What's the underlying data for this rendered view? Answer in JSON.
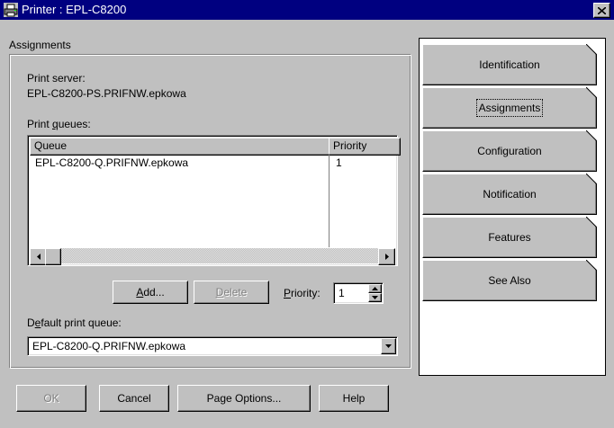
{
  "window": {
    "title": "Printer : EPL-C8200"
  },
  "page": {
    "heading": "Assignments",
    "print_server_label": "Print server:",
    "print_server_value": "EPL-C8200-PS.PRIFNW.epkowa",
    "print_queues_label": "Print queues:",
    "queues_table": {
      "columns": [
        "Queue",
        "Priority"
      ],
      "rows": [
        {
          "queue": "EPL-C8200-Q.PRIFNW.epkowa",
          "priority": "1"
        }
      ]
    },
    "add_label": "Add...",
    "delete_label": "Delete",
    "priority_label": "Priority:",
    "priority_value": "1",
    "default_queue_label": "Default print queue:",
    "default_queue_value": "EPL-C8200-Q.PRIFNW.epkowa"
  },
  "tabs": [
    {
      "label": "Identification"
    },
    {
      "label": "Assignments"
    },
    {
      "label": "Configuration"
    },
    {
      "label": "Notification"
    },
    {
      "label": "Features"
    },
    {
      "label": "See Also"
    }
  ],
  "footer": {
    "ok_label": "OK",
    "cancel_label": "Cancel",
    "page_options_label": "Page Options...",
    "help_label": "Help"
  },
  "icons": {
    "printer": "printer-icon",
    "close": "close-icon",
    "scroll_left": "arrow-left-icon",
    "scroll_right": "arrow-right-icon",
    "dropdown": "arrow-down-icon"
  }
}
